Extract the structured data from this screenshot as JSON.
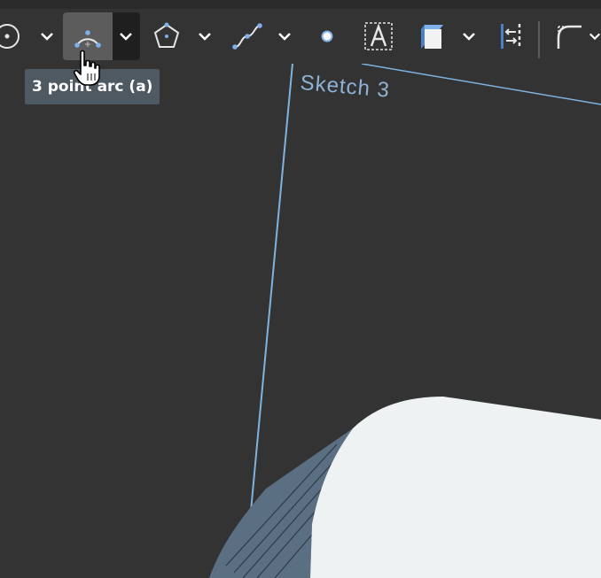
{
  "toolbar": {
    "tools": [
      {
        "id": "circle",
        "icon": "circle-icon"
      },
      {
        "id": "three-point-arc",
        "icon": "three-point-arc-icon",
        "active": true
      },
      {
        "id": "polygon",
        "icon": "polygon-icon"
      },
      {
        "id": "spline",
        "icon": "spline-icon"
      },
      {
        "id": "point",
        "icon": "point-icon"
      },
      {
        "id": "text",
        "icon": "text-icon"
      },
      {
        "id": "construction",
        "icon": "construction-icon"
      },
      {
        "id": "dimension",
        "icon": "dimension-icon"
      },
      {
        "id": "fillet",
        "icon": "fillet-icon"
      }
    ],
    "tooltip": "3 point arc (a)"
  },
  "viewport": {
    "sketch_label": "Sketch 3"
  },
  "colors": {
    "background": "#333333",
    "accent": "#8fb3d6",
    "tooltip_bg": "#4f5962"
  }
}
